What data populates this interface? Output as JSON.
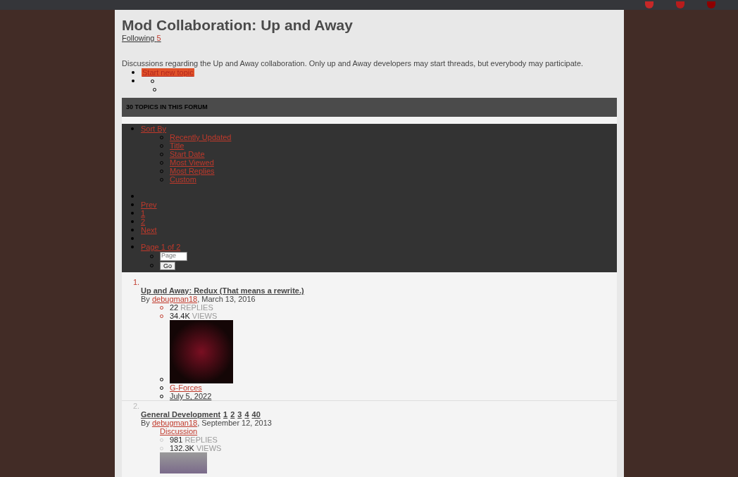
{
  "forum": {
    "title": "Mod Collaboration: Up and Away",
    "following_label": "Following",
    "following_count": "5",
    "description": "Discussions regarding the Up and Away collaboration. Only up and Away developers may start threads, but everybody may participate.",
    "start_button": "Start new topic",
    "topics_header": "30 TOPICS IN THIS FORUM"
  },
  "sort": {
    "label": "Sort By",
    "options": [
      "Recently Updated",
      "Title",
      "Start Date",
      "Most Viewed",
      "Most Replies",
      "Custom"
    ]
  },
  "pagination": {
    "prev": "Prev",
    "pages": [
      "1",
      "2"
    ],
    "next": "Next",
    "page_label": "Page 1 of 2",
    "jump_placeholder": "Page",
    "go": "Go"
  },
  "topics": [
    {
      "number": "1.",
      "title": "Up and Away: Redux (That means a rewrite.)",
      "by": "By",
      "author": "debugman18",
      "date": ", March 13, 2016",
      "replies_count": "22",
      "replies_label": "REPLIES",
      "views_count": "34.4K",
      "views_label": "VIEWS",
      "last_poster": "G-Forces",
      "last_date": "July 5, 2022",
      "unread": true
    },
    {
      "number": "2.",
      "title": "General Development",
      "pages": [
        "1",
        "2",
        "3",
        "4",
        "40"
      ],
      "by": "By",
      "author": "debugman18",
      "date": ", September 12, 2013",
      "tag": "Discussion",
      "replies_count": "981",
      "replies_label": "REPLIES",
      "views_count": "132.3K",
      "views_label": "VIEWS",
      "unread": false
    }
  ]
}
